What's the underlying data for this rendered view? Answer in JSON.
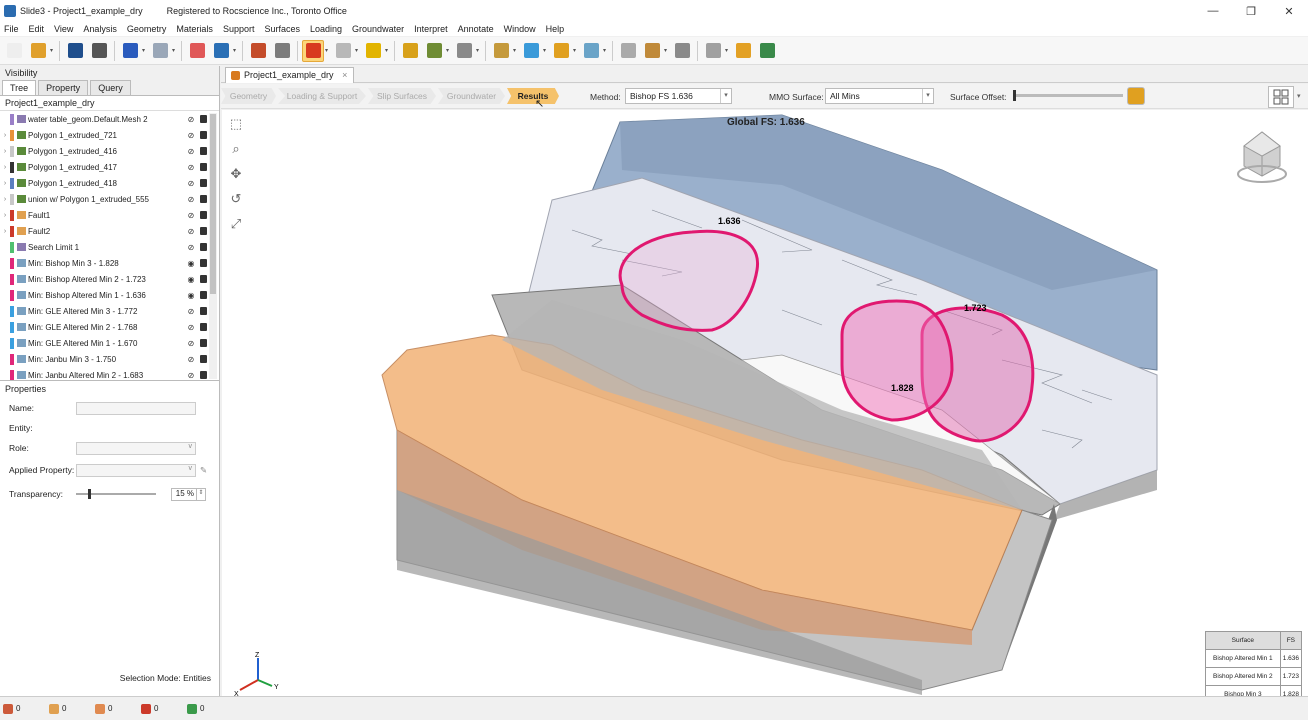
{
  "window": {
    "title": "Slide3 - Project1_example_dry",
    "registration": "Registered to Rocscience Inc., Toronto Office",
    "controls": [
      "—",
      "❐",
      "✕"
    ]
  },
  "menu": [
    "File",
    "Edit",
    "View",
    "Analysis",
    "Geometry",
    "Materials",
    "Support",
    "Surfaces",
    "Loading",
    "Groundwater",
    "Interpret",
    "Annotate",
    "Window",
    "Help"
  ],
  "toolbar": {
    "icons": [
      "new-file-icon",
      "open-folder-icon",
      "save-icon",
      "print-icon",
      "undo-icon",
      "redo-icon",
      "color-wheel-icon",
      "image-export-icon",
      "edit-pencil-icon",
      "calculator-icon",
      "compute-cube-icon",
      "wireframe-cube-icon",
      "locked-cube-icon",
      "material-cubes-icon",
      "support-icon",
      "cloud-icon",
      "cube-settings-icon",
      "slice-icon",
      "triangle-icon",
      "view-cube-icon",
      "box-icon",
      "move-icon",
      "tools-icon",
      "dots-icon",
      "contour-icon",
      "layers-icon"
    ],
    "colors": [
      "#eeeeee",
      "#e0a02c",
      "#1f4e8c",
      "#555555",
      "#2a5bbd",
      "#9aa7b8",
      "#e05858",
      "#2a6fb5",
      "#c44c2a",
      "#7c7c7c",
      "#d83a1f",
      "#b8b8b8",
      "#e2b400",
      "#d8a11a",
      "#6f8c34",
      "#8a8a8a",
      "#c59a3c",
      "#3a9ad9",
      "#e0a020",
      "#6aa4c8",
      "#aaaaaa",
      "#c08a3a",
      "#8a8a8a",
      "#a0a0a0",
      "#e3a125",
      "#3a8a4a"
    ]
  },
  "left": {
    "visibility_label": "Visibility",
    "tabs": [
      "Tree",
      "Property",
      "Query"
    ],
    "project_name": "Project1_example_dry",
    "tree": [
      {
        "label": "water table_geom.Default.Mesh 2",
        "color": "#9a7fc8",
        "icon": "pencil-icon",
        "visible": false
      },
      {
        "label": "Polygon 1_extruded_721",
        "color": "#e8913a",
        "icon": "mountain-icon",
        "visible": false
      },
      {
        "label": "Polygon 1_extruded_416",
        "color": "#c8c8c8",
        "icon": "mountain-icon",
        "visible": false
      },
      {
        "label": "Polygon 1_extruded_417",
        "color": "#333333",
        "icon": "mountain-icon",
        "visible": false
      },
      {
        "label": "Polygon 1_extruded_418",
        "color": "#5c7fc0",
        "icon": "mountain-icon",
        "visible": false
      },
      {
        "label": "union w/ Polygon 1_extruded_555",
        "color": "#c8c8c8",
        "icon": "mountain-icon",
        "visible": false
      },
      {
        "label": "Fault1",
        "color": "#cc3a2a",
        "icon": "fault-icon",
        "visible": false
      },
      {
        "label": "Fault2",
        "color": "#cc3a2a",
        "icon": "fault-icon",
        "visible": false
      },
      {
        "label": "Search Limit 1",
        "color": "#50c070",
        "icon": "search-limit-icon",
        "visible": false
      },
      {
        "label": "Min: Bishop Min 3  -  1.828",
        "color": "#e0287a",
        "icon": "min-surface-icon",
        "visible": true
      },
      {
        "label": "Min: Bishop Altered Min 2  -  1.723",
        "color": "#e0287a",
        "icon": "min-surface-icon",
        "visible": true
      },
      {
        "label": "Min: Bishop Altered Min 1  -  1.636",
        "color": "#e0287a",
        "icon": "min-surface-icon",
        "visible": true
      },
      {
        "label": "Min: GLE Altered Min 3  -  1.772",
        "color": "#3aa0e0",
        "icon": "min-surface-icon",
        "visible": false
      },
      {
        "label": "Min: GLE Altered Min 2  -  1.768",
        "color": "#3aa0e0",
        "icon": "min-surface-icon",
        "visible": false
      },
      {
        "label": "Min: GLE Altered Min 1  -  1.670",
        "color": "#3aa0e0",
        "icon": "min-surface-icon",
        "visible": false
      },
      {
        "label": "Min: Janbu Min 3  -  1.750",
        "color": "#e0287a",
        "icon": "min-surface-icon",
        "visible": false
      },
      {
        "label": "Min: Janbu Altered Min 2  -  1.683",
        "color": "#e0287a",
        "icon": "min-surface-icon",
        "visible": false
      }
    ],
    "properties": {
      "header": "Properties",
      "name_label": "Name:",
      "entity_label": "Entity:",
      "role_label": "Role:",
      "applied_property_label": "Applied Property:",
      "transparency_label": "Transparency:",
      "transparency_value": "15 %",
      "selection_mode": "Selection Mode:  Entities"
    }
  },
  "status_bar": [
    {
      "icon": "nodes-icon",
      "count": "0",
      "color": "#cc5a3a"
    },
    {
      "icon": "edges-icon",
      "count": "0",
      "color": "#e0a050"
    },
    {
      "icon": "faces-icon",
      "count": "0",
      "color": "#e08a50"
    },
    {
      "icon": "solids-icon",
      "count": "0",
      "color": "#cc3a2a"
    },
    {
      "icon": "groups-icon",
      "count": "0",
      "color": "#3a9a4a"
    }
  ],
  "document_tab": {
    "label": "Project1_example_dry",
    "close": "×"
  },
  "workflow": {
    "steps": [
      "Geometry",
      "Loading & Support",
      "Slip Surfaces",
      "Groundwater",
      "Results"
    ],
    "current_step": "Results",
    "method_label": "Method:",
    "method_value": "Bishop FS    1.636",
    "mmo_label": "MMO Surface:",
    "mmo_value": "All Mins",
    "offset_label": "Surface Offset:",
    "offset_fraction": 0.0
  },
  "viewport": {
    "global_fs": "Global FS: 1.636",
    "surface_labels": [
      "1.636",
      "1.723",
      "1.828"
    ],
    "axis_labels": [
      "Z",
      "X",
      "Y"
    ],
    "fs_table": {
      "headers": [
        "Surface",
        "FS"
      ],
      "rows": [
        [
          "Bishop Altered Min 1",
          "1.636"
        ],
        [
          "Bishop Altered Min 2",
          "1.723"
        ],
        [
          "Bishop Min 3",
          "1.828"
        ]
      ]
    }
  }
}
